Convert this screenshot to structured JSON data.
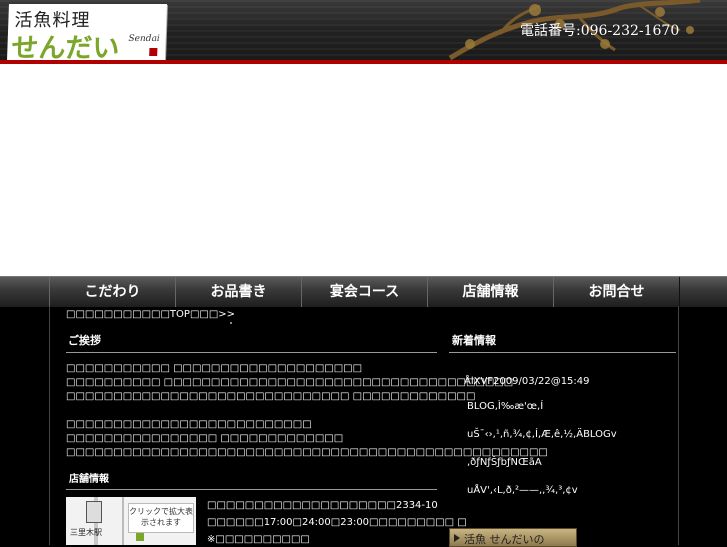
{
  "header": {
    "logo_top": "活魚料理",
    "logo_main": "せんだい",
    "logo_sub": "Sendai",
    "phone": "電話番号:096-232-1670"
  },
  "nav": {
    "items": [
      "こだわり",
      "お品書き",
      "宴会コース",
      "店舗情報",
      "お問合せ"
    ]
  },
  "breadcrumb": "□□□□□□□□□□□TOP□□□>>",
  "greeting": {
    "title": "ご挨拶",
    "lines": [
      "□□□□□□□□□□□ □□□□□□□□□□□□□□□□□□□□",
      "□□□□□□□□□□ □□□□□□□□□□□□□□□□□□□□□□□□□□□□□□□□□□□□□",
      "□□□□□□□□□□□□□□□□□□□□□□□□□□□□□□ □□□□□□□□□□□□□",
      "",
      "□□□□□□□□□□□□□□□□□□□□□□□□□□",
      "□□□□□□□□□□□□□□□□ □□□□□□□□□□□□□",
      "□□□□□□□□□□□□□□□□□□□□□□□□□□□□□□□□□□□□□□□□□□□□□□□□□□□"
    ]
  },
  "shop": {
    "title": "店舗情報",
    "map_station": "三里木駅",
    "map_note": "クリックで拡大表示されます",
    "info_lines": [
      "□□□□□□□□□□□□□□□□□□□□2334-10",
      "□□□□□□17:00□24:00□23:00□□□□□□□□□ □",
      "※□□□□□□□□□□"
    ]
  },
  "news": {
    "title": "新着情報",
    "items": [
      "ÅlXVF2009/03/22@15:49",
      "BLOG,Ì‰æ'œ,Í",
      "uŠ¯‹›,¹,ñ,¾,¢,Í,Æ,ê,½,ÄBLOGv",
      ",ðƒNƒŠƒbƒNŒãA",
      "uÅV'‚‹L,ð,²——,,¾,³,¢v"
    ]
  },
  "bottom_banner": {
    "label": "活魚 せんだいの"
  }
}
